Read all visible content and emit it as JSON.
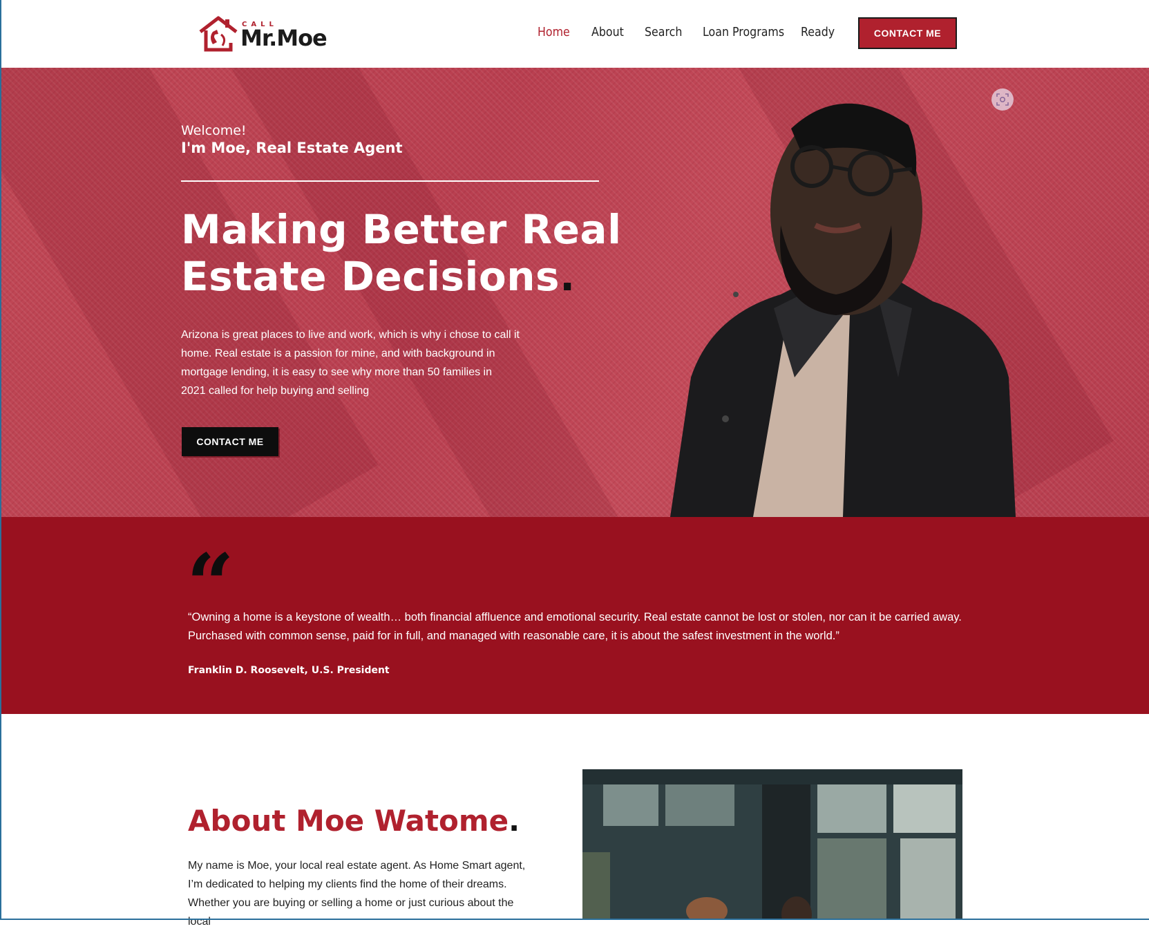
{
  "logo": {
    "call": "CALL",
    "name": "Mr.Moe"
  },
  "nav": {
    "items": [
      {
        "label": "Home",
        "active": true
      },
      {
        "label": "About",
        "active": false
      },
      {
        "label": "Search",
        "active": false
      },
      {
        "label": "Loan Programs",
        "active": false
      },
      {
        "label": "Ready",
        "active": false
      }
    ],
    "contact_button": "CONTACT ME"
  },
  "hero": {
    "welcome": "Welcome!",
    "intro": "I'm Moe, Real Estate Agent",
    "title_line1": "Making Better Real",
    "title_line2": "Estate Decisions",
    "title_dot": ".",
    "paragraph": "Arizona is great places to live and work, which is why i chose to call it home.  Real estate is a passion for mine, and with background in mortgage lending, it is easy to see why more than 50 families in 2021 called for help buying and selling",
    "contact_button": "CONTACT ME"
  },
  "quote": {
    "mark": "“",
    "text": "“Owning a home is a keystone of wealth… both financial affluence and emotional security. Real estate cannot be lost or stolen, nor can it be carried away. Purchased with common sense, paid for in full, and managed with reasonable care, it is about the safest investment in the world.”",
    "author": "Franklin D. Roosevelt, U.S. President"
  },
  "about": {
    "title": "About Moe Watome",
    "title_dot": ".",
    "paragraph": "My name is Moe, your local real estate agent. As Home Smart agent, I’m dedicated to helping my clients find the home of their dreams. Whether you are buying or selling a home or just curious about the local"
  },
  "colors": {
    "brand": "#b0212e",
    "quote_bg": "#99111f",
    "hero_bg": "#c04755",
    "dark": "#0d0d0d"
  },
  "icons": {
    "logo": "house-phone-icon",
    "photo_badge": "focus-scan-icon",
    "quote": "quote-icon"
  }
}
